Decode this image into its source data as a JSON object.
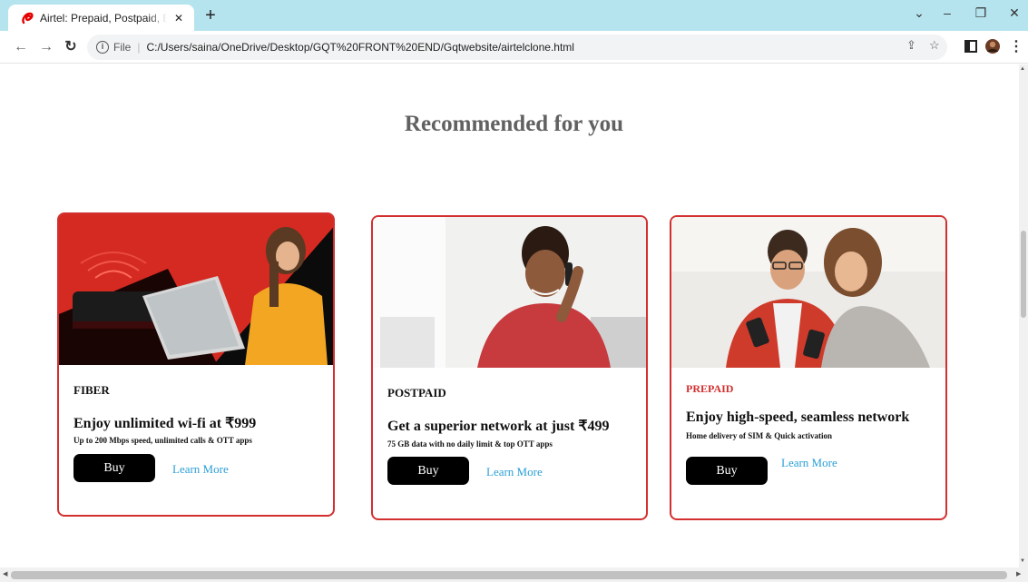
{
  "browser": {
    "tab_title": "Airtel: Prepaid, Postpaid, Broadband, DTH & more",
    "url_scheme": "File",
    "url": "C:/Users/saina/OneDrive/Desktop/GQT%20FRONT%20END/Gqtwebsite/airtelclone.html",
    "icons": {
      "back": "back-arrow-icon",
      "forward": "forward-arrow-icon",
      "reload": "reload-icon",
      "info": "info-icon",
      "share": "share-icon",
      "bookmark": "star-icon",
      "sidepanel": "side-panel-icon",
      "profile": "profile-avatar",
      "menu": "kebab-menu-icon"
    },
    "accent_color": "#b5e3ee"
  },
  "page": {
    "section_title": "Recommended for you",
    "accent_color": "#d32f2f",
    "link_color": "#2a9fd6",
    "cards": [
      {
        "category": "FIBER",
        "category_color": "#111111",
        "headline": "Enjoy unlimited wi-fi at ₹999",
        "subtext": "Up to 200 Mbps speed, unlimited calls & OTT apps",
        "buy_label": "Buy",
        "learn_label": "Learn More"
      },
      {
        "category": "POSTPAID",
        "category_color": "#111111",
        "headline": "Get a superior network at just ₹499",
        "subtext": "75 GB data with no daily limit & top OTT apps",
        "buy_label": "Buy",
        "learn_label": "Learn More"
      },
      {
        "category": "PREPAID",
        "category_color": "#d32f2f",
        "headline": "Enjoy high-speed, seamless network",
        "subtext": "Home delivery of SIM & Quick activation",
        "buy_label": "Buy",
        "learn_label": "Learn More"
      }
    ]
  }
}
